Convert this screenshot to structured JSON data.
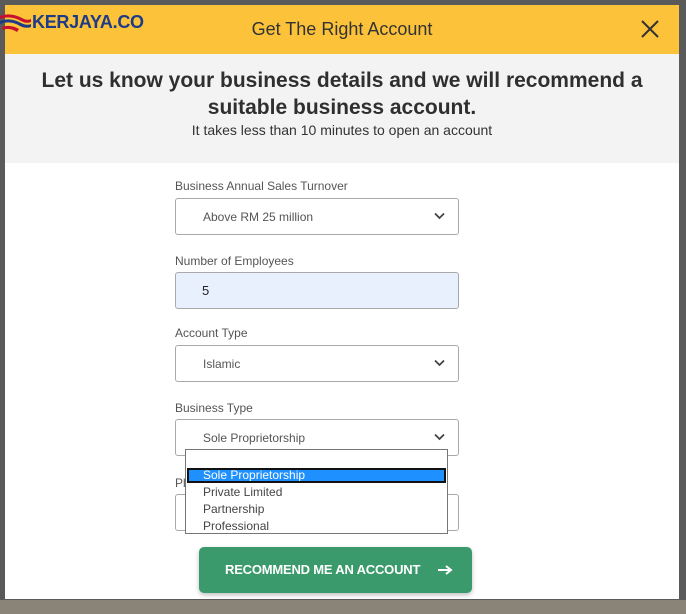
{
  "logo": {
    "text": "KERJAYA.CO"
  },
  "modal": {
    "title": "Get The Right Account",
    "close_icon": "close-icon"
  },
  "intro": {
    "heading": "Let us know your business details and we will recommend a suitable business account.",
    "subheading": "It takes less than 10 minutes to open an account"
  },
  "form": {
    "sales_turnover": {
      "label": "Business Annual Sales Turnover",
      "value": "Above RM 25 million"
    },
    "employees": {
      "label": "Number of Employees",
      "value": "5"
    },
    "account_type": {
      "label": "Account Type",
      "value": "Islamic"
    },
    "business_type": {
      "label": "Business Type",
      "value": "Sole Proprietorship",
      "options": [
        "Sole Proprietorship",
        "Private Limited",
        "Partnership",
        "Professional"
      ],
      "selected_index": 0
    },
    "hidden_field_label_fragment": "Pl"
  },
  "submit": {
    "label": "RECOMMEND ME AN ACCOUNT",
    "icon": "arrow-right-icon"
  },
  "colors": {
    "header": "#fcc23a",
    "button": "#3a9a6b",
    "highlight": "#1e90ff",
    "logo_text": "#1d3b87"
  }
}
